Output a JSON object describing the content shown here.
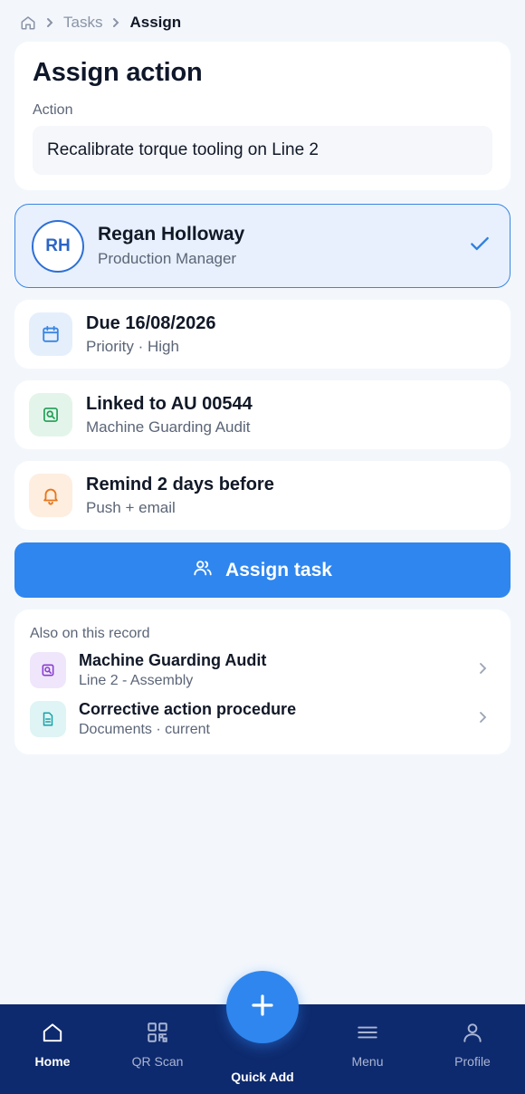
{
  "breadcrumb": {
    "items": [
      "Tasks",
      "Assign"
    ]
  },
  "header": {
    "title": "Assign action",
    "action_label": "Action",
    "action_value": "Recalibrate torque tooling on Line 2"
  },
  "assignee": {
    "initials": "RH",
    "name": "Regan Holloway",
    "role": "Production Manager",
    "selected": true
  },
  "details": [
    {
      "icon": "calendar-icon",
      "title": "Due 16/08/2026",
      "subtitle": "Priority · High",
      "color": "#3a86e2"
    },
    {
      "icon": "audit-search-icon",
      "title": "Linked to AU 00544",
      "subtitle": "Machine Guarding Audit",
      "color": "#1f9d55"
    },
    {
      "icon": "bell-icon",
      "title": "Remind 2 days before",
      "subtitle": "Push + email",
      "color": "#e8761c"
    }
  ],
  "primary_action": {
    "label": "Assign task",
    "icon": "users-icon"
  },
  "also": {
    "label": "Also on this record",
    "items": [
      {
        "icon": "audit-search-icon",
        "title": "Machine Guarding Audit",
        "subtitle": "Line 2 - Assembly"
      },
      {
        "icon": "document-icon",
        "title": "Corrective action procedure",
        "subtitle": "Documents · current"
      }
    ]
  },
  "nav": {
    "items": [
      {
        "label": "Home",
        "icon": "home-icon",
        "active": true
      },
      {
        "label": "QR Scan",
        "icon": "qr-icon",
        "active": false
      },
      {
        "label": "Menu",
        "icon": "menu-icon",
        "active": false
      },
      {
        "label": "Profile",
        "icon": "user-icon",
        "active": false
      }
    ],
    "quick_add": "Quick Add"
  },
  "colors": {
    "accent": "#2f86ee",
    "nav_bg": "#0e2a6e",
    "page_bg": "#f3f7fc"
  }
}
